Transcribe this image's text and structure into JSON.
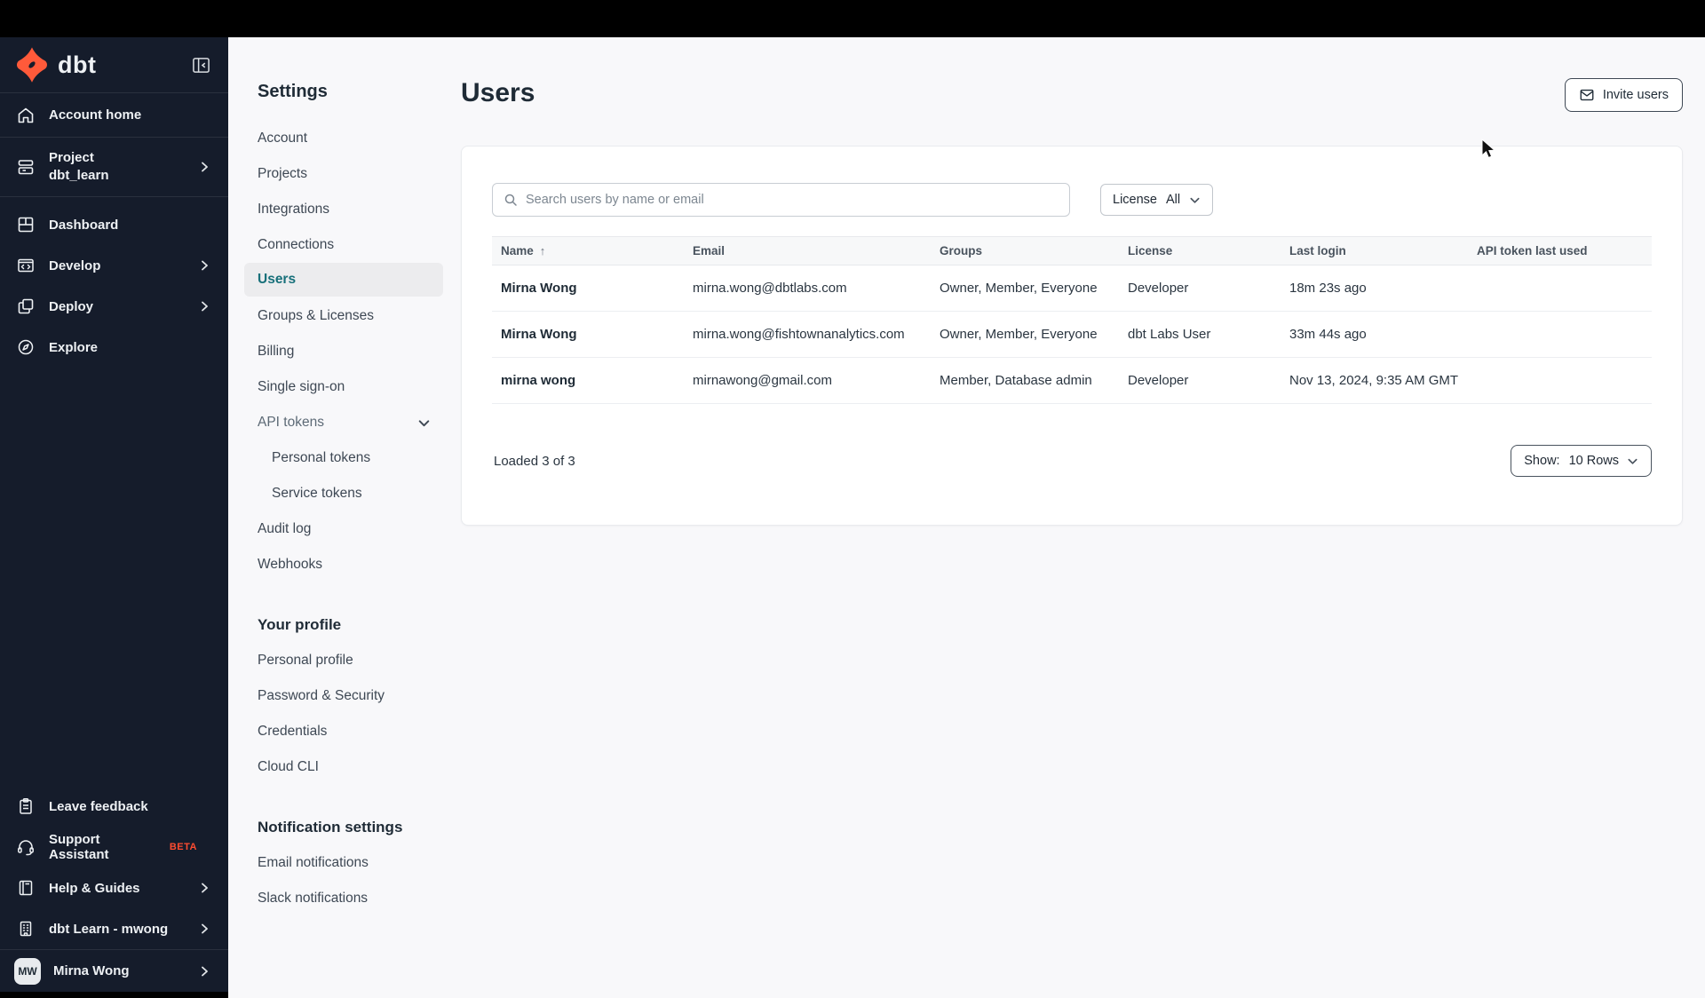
{
  "colors": {
    "accent_orange": "#ff5a3a",
    "active_teal": "#17707a",
    "sidebar_bg": "#151c2b",
    "page_bg": "#f8f8fa"
  },
  "sidebar": {
    "logo_text": "dbt",
    "items": [
      {
        "label": "Account home"
      },
      {
        "label": "Project",
        "sublabel": "dbt_learn",
        "chevron": true
      },
      {
        "label": "Dashboard"
      },
      {
        "label": "Develop",
        "chevron": true
      },
      {
        "label": "Deploy",
        "chevron": true
      },
      {
        "label": "Explore"
      }
    ],
    "footer_items": [
      {
        "label": "Leave feedback"
      },
      {
        "label": "Support Assistant",
        "badge": "BETA"
      },
      {
        "label": "Help & Guides",
        "chevron": true
      },
      {
        "label": "dbt Learn - mwong",
        "chevron": true
      }
    ],
    "user": {
      "initials": "MW",
      "name": "Mirna Wong",
      "chevron": true
    }
  },
  "settings_nav": {
    "items": [
      {
        "label": "Settings",
        "type": "title"
      },
      {
        "label": "Account",
        "type": "item"
      },
      {
        "label": "Projects",
        "type": "item"
      },
      {
        "label": "Integrations",
        "type": "item"
      },
      {
        "label": "Connections",
        "type": "item"
      },
      {
        "label": "Users",
        "type": "item",
        "active": true
      },
      {
        "label": "Groups & Licenses",
        "type": "item"
      },
      {
        "label": "Billing",
        "type": "item"
      },
      {
        "label": "Single sign-on",
        "type": "item"
      },
      {
        "label": "API tokens",
        "type": "item",
        "muted": true,
        "chevron": true
      },
      {
        "label": "Personal tokens",
        "type": "item",
        "indent": true
      },
      {
        "label": "Service tokens",
        "type": "item",
        "indent": true
      },
      {
        "label": "Audit log",
        "type": "item"
      },
      {
        "label": "Webhooks",
        "type": "item"
      },
      {
        "label": "Your profile",
        "type": "section"
      },
      {
        "label": "Personal profile",
        "type": "item"
      },
      {
        "label": "Password & Security",
        "type": "item"
      },
      {
        "label": "Credentials",
        "type": "item"
      },
      {
        "label": "Cloud CLI",
        "type": "item"
      },
      {
        "label": "Notification settings",
        "type": "section"
      },
      {
        "label": "Email notifications",
        "type": "item"
      },
      {
        "label": "Slack notifications",
        "type": "item"
      }
    ]
  },
  "main": {
    "title": "Users",
    "invite_button": "Invite users",
    "search_placeholder": "Search users by name or email",
    "license_filter": {
      "label": "License",
      "value": "All"
    },
    "table": {
      "headers": [
        "Name",
        "Email",
        "Groups",
        "License",
        "Last login",
        "API token last used"
      ],
      "sort_column": "Name",
      "sort_direction": "asc",
      "rows": [
        [
          "Mirna Wong",
          "mirna.wong@dbtlabs.com",
          "Owner, Member, Everyone",
          "Developer",
          "18m 23s ago",
          ""
        ],
        [
          "Mirna Wong",
          "mirna.wong@fishtownanalytics.com",
          "Owner, Member, Everyone",
          "dbt Labs User",
          "33m 44s ago",
          ""
        ],
        [
          "mirna wong",
          "mirnawong@gmail.com",
          "Member, Database admin",
          "Developer",
          "Nov 13, 2024, 9:35 AM GMT",
          ""
        ]
      ]
    },
    "footer": {
      "loaded": "Loaded 3 of 3",
      "show_label": "Show:",
      "show_value": "10 Rows"
    }
  }
}
